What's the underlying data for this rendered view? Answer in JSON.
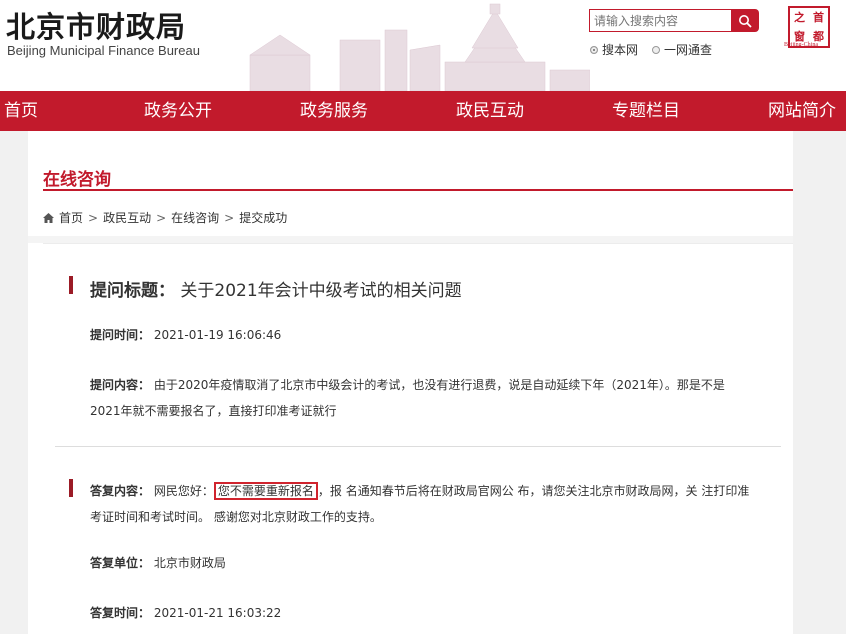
{
  "header": {
    "logo_cn": "北京市财政局",
    "logo_en": "Beijing Municipal Finance Bureau",
    "search_placeholder": "请输入搜索内容",
    "radio_options": [
      "搜本网",
      "一网通查"
    ],
    "seal_chars": [
      "之",
      "首",
      "窗",
      "都"
    ],
    "seal_sub": "Beijing-China"
  },
  "nav": {
    "items": [
      "首页",
      "政务公开",
      "政务服务",
      "政民互动",
      "专题栏目",
      "网站简介"
    ]
  },
  "section": {
    "title": "在线咨询"
  },
  "breadcrumb": [
    "首页",
    "政民互动",
    "在线咨询",
    "提交成功"
  ],
  "question": {
    "title_label": "提问标题：",
    "title": "关于2021年会计中级考试的相关问题",
    "time_label": "提问时间：",
    "time": "2021-01-19 16:06:46",
    "content_label": "提问内容：",
    "content_line1": "由于2020年疫情取消了北京市中级会计的考试，也没有进行退费，说是自动延续下年（2021年）。那是不是",
    "content_line2": "2021年就不需要报名了，直接打印准考证就行"
  },
  "answer": {
    "content_label": "答复内容：",
    "content_pre": "网民您好：",
    "content_highlight": "您不需要重新报名",
    "content_post": "，报 名通知春节后将在财政局官网公 布，请您关注北京市财政局网，关 注打印准",
    "content_line2": "考证时间和考试时间。 感谢您对北京财政工作的支持。",
    "unit_label": "答复单位：",
    "unit": "北京市财政局",
    "time_label": "答复时间：",
    "time": "2021-01-21 16:03:22"
  },
  "colors": {
    "brand_red": "#c21a2c",
    "accent_bar": "#9b1b26"
  }
}
